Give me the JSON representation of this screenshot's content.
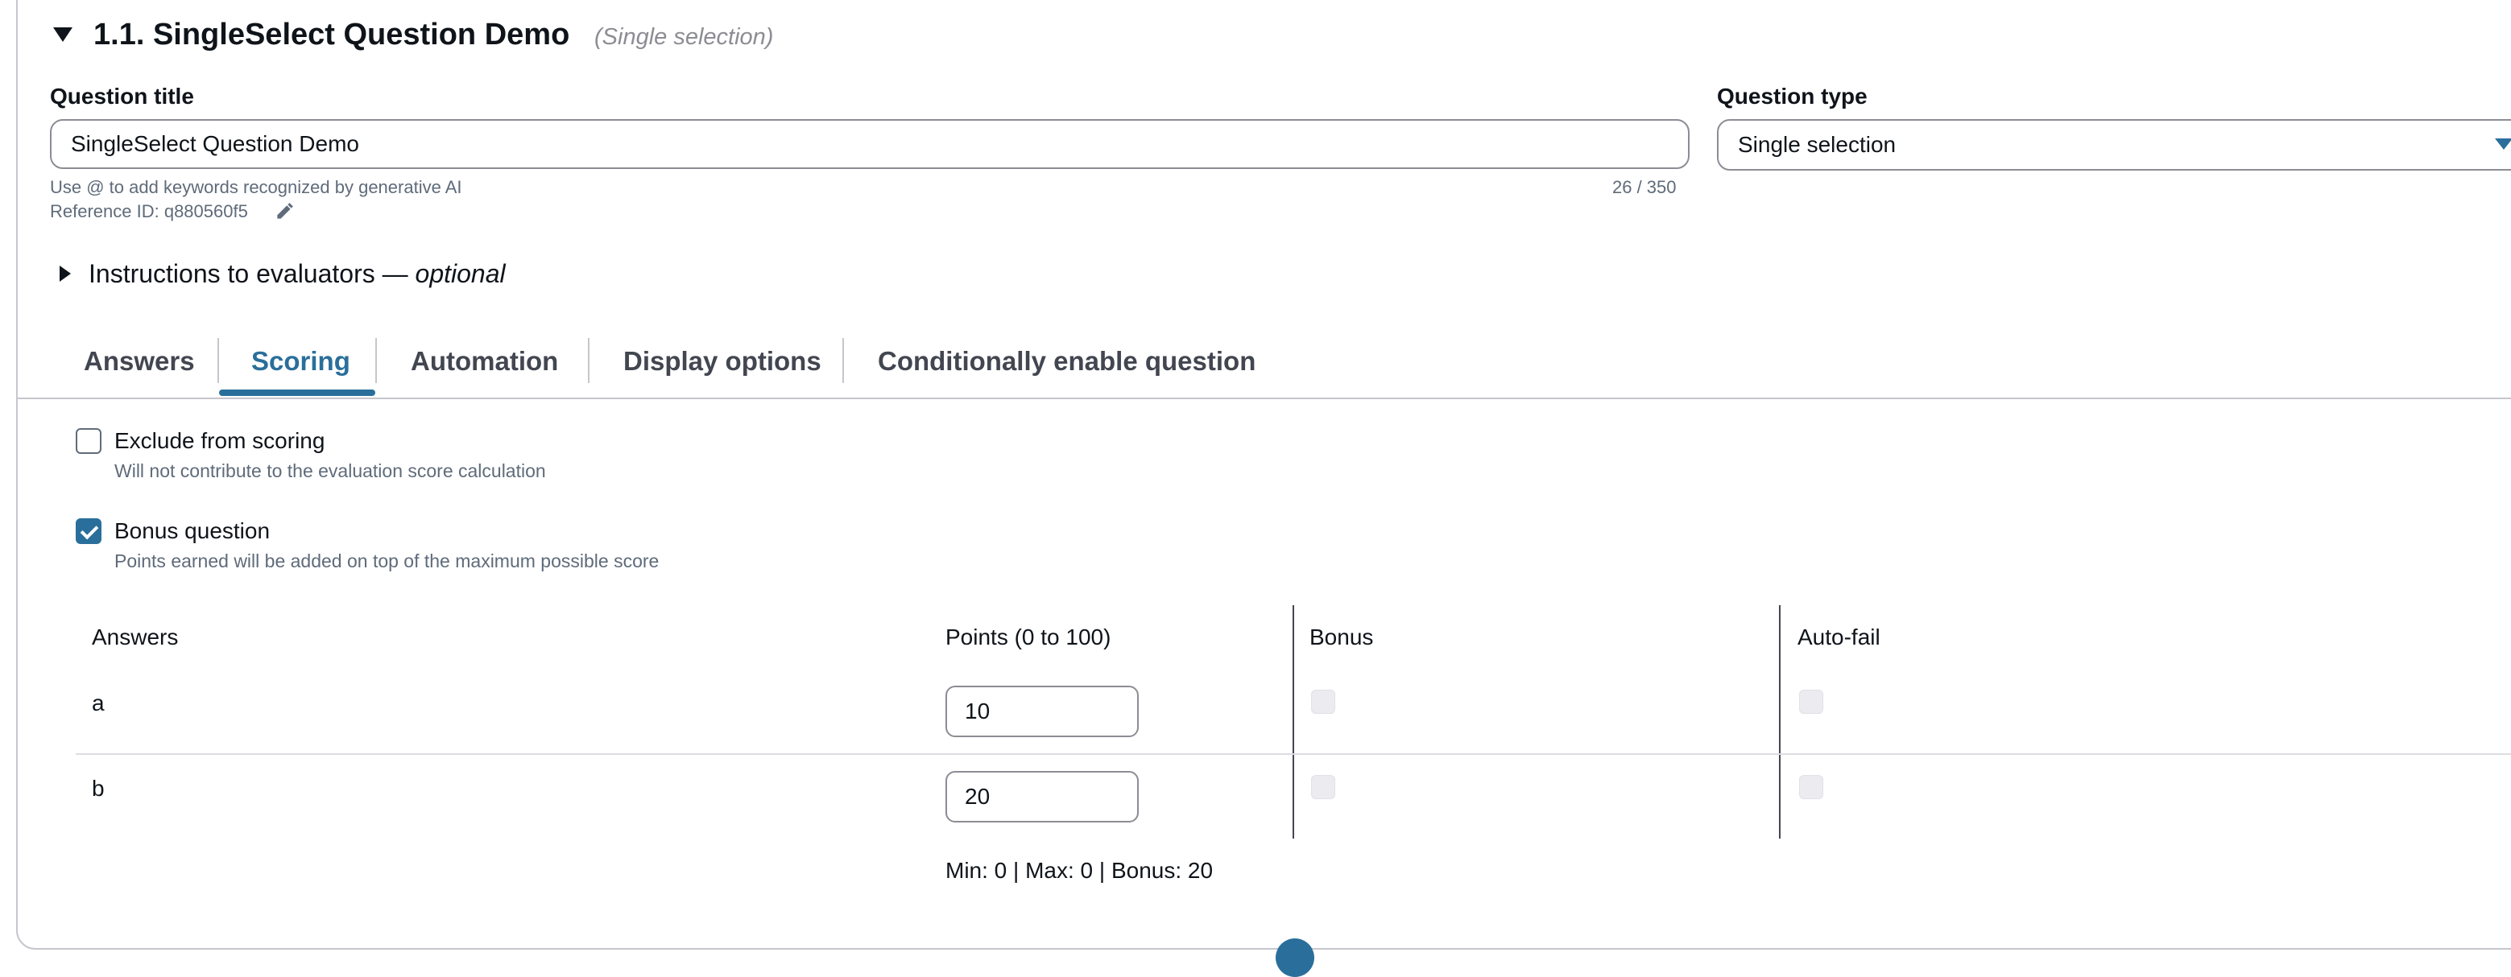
{
  "question": {
    "heading": "1.1. SingleSelect Question Demo",
    "heading_type": "(Single selection)",
    "title_label": "Question title",
    "title_value": "SingleSelect Question Demo",
    "title_hint": "Use @ to add keywords recognized by generative AI",
    "char_count": "26 / 350",
    "reference_id": "Reference ID: q880560f5",
    "type_label": "Question type",
    "type_value": "Single selection"
  },
  "instructions": {
    "label": "Instructions to evaluators — ",
    "optional": "optional"
  },
  "tabs": [
    {
      "label": "Answers",
      "active": false
    },
    {
      "label": "Scoring",
      "active": true
    },
    {
      "label": "Automation",
      "active": false
    },
    {
      "label": "Display options",
      "active": false
    },
    {
      "label": "Conditionally enable question",
      "active": false
    }
  ],
  "scoring": {
    "exclude": {
      "label": "Exclude from scoring",
      "description": "Will not contribute to the evaluation score calculation",
      "checked": false
    },
    "bonus": {
      "label": "Bonus question",
      "description": "Points earned will be added on top of the maximum possible score",
      "checked": true
    },
    "table": {
      "headers": [
        "Answers",
        "Points (0 to 100)",
        "Bonus",
        "Auto-fail"
      ],
      "rows": [
        {
          "answer": "a",
          "points": "10"
        },
        {
          "answer": "b",
          "points": "20"
        }
      ]
    },
    "summary": "Min: 0 | Max: 0 | Bonus: 20"
  },
  "colors": {
    "accent": "#2a6f9b",
    "border": "#8c8c94",
    "text": "#0f141a",
    "muted": "#5f6b7a"
  }
}
